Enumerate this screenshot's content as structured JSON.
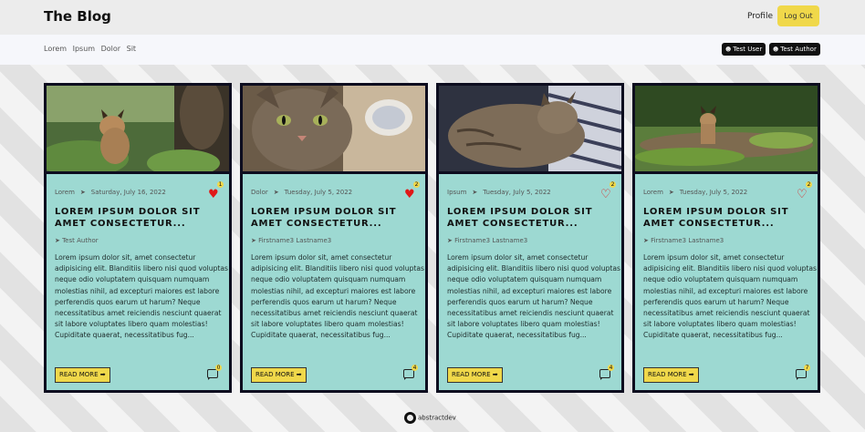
{
  "header": {
    "brand": "The Blog",
    "profile_label": "Profile",
    "logout_label": "Log Out"
  },
  "categories": [
    "Lorem",
    "Ipsum",
    "Dolor",
    "Sit"
  ],
  "users": [
    {
      "label": "Test User",
      "icon": "user-icon"
    },
    {
      "label": "Test Author",
      "icon": "user-icon"
    }
  ],
  "cards": [
    {
      "category": "Lorem",
      "date": "Saturday, July 16, 2022",
      "likes": "1",
      "liked": true,
      "title": "LOREM IPSUM DOLOR SIT AMET CONSECTETUR...",
      "author": "Test Author",
      "excerpt": "Lorem ipsum dolor sit, amet consectetur adipisicing elit. Blanditiis libero nisi quod voluptas neque odio voluptatem quisquam numquam molestias nihil, ad excepturi maiores est labore perferendis quos earum ut harum? Neque necessitatibus amet reiciendis nesciunt quaerat sit labore voluptates libero quam molestias! Cupiditate quaerat, necessitatibus fug...",
      "read_more": "READ MORE ➡",
      "comments": "0",
      "image": "lynx-cub-forest"
    },
    {
      "category": "Dolor",
      "date": "Tuesday, July 5, 2022",
      "likes": "2",
      "liked": true,
      "title": "LOREM IPSUM DOLOR SIT AMET CONSECTETUR...",
      "author": "Firstname3 Lastname3",
      "excerpt": "Lorem ipsum dolor sit, amet consectetur adipisicing elit. Blanditiis libero nisi quod voluptas neque odio voluptatem quisquam numquam molestias nihil, ad excepturi maiores est labore perferendis quos earum ut harum? Neque necessitatibus amet reiciendis nesciunt quaerat sit labore voluptates libero quam molestias! Cupiditate quaerat, necessitatibus fug...",
      "read_more": "READ MORE ➡",
      "comments": "4",
      "image": "tabby-cat-closeup"
    },
    {
      "category": "Ipsum",
      "date": "Tuesday, July 5, 2022",
      "likes": "2",
      "liked": false,
      "title": "LOREM IPSUM DOLOR SIT AMET CONSECTETUR...",
      "author": "Firstname3 Lastname3",
      "excerpt": "Lorem ipsum dolor sit, amet consectetur adipisicing elit. Blanditiis libero nisi quod voluptas neque odio voluptatem quisquam numquam molestias nihil, ad excepturi maiores est labore perferendis quos earum ut harum? Neque necessitatibus amet reiciendis nesciunt quaerat sit labore voluptates libero quam molestias! Cupiditate quaerat, necessitatibus fug...",
      "read_more": "READ MORE ➡",
      "comments": "4",
      "image": "cat-lying-blanket"
    },
    {
      "category": "Lorem",
      "date": "Tuesday, July 5, 2022",
      "likes": "2",
      "liked": false,
      "title": "LOREM IPSUM DOLOR SIT AMET CONSECTETUR...",
      "author": "Firstname3 Lastname3",
      "excerpt": "Lorem ipsum dolor sit, amet consectetur adipisicing elit. Blanditiis libero nisi quod voluptas neque odio voluptatem quisquam numquam molestias nihil, ad excepturi maiores est labore perferendis quos earum ut harum? Neque necessitatibus amet reiciendis nesciunt quaerat sit labore voluptates libero quam molestias! Cupiditate quaerat, necessitatibus fug...",
      "read_more": "READ MORE ➡",
      "comments": "7",
      "image": "lynx-on-log"
    }
  ],
  "footer": {
    "label": "abstractdev",
    "icon": "github-icon"
  },
  "colors": {
    "card_bg": "#9dd9d2",
    "accent_yellow": "#f0d84a",
    "card_border": "#0d0d1f",
    "like_red": "#e01818"
  }
}
